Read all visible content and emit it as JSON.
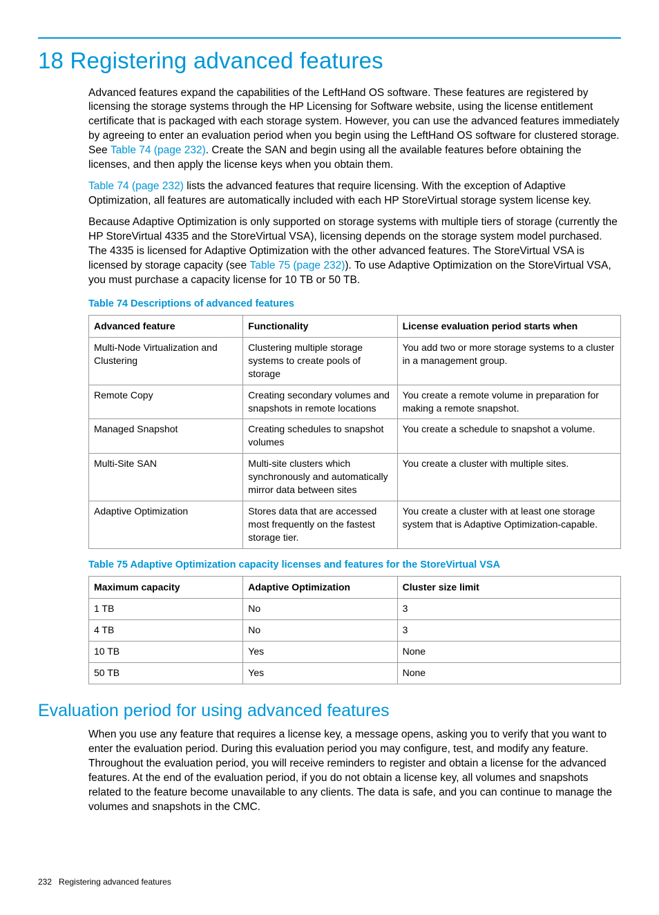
{
  "chapter": {
    "title": "18 Registering advanced features"
  },
  "paragraphs": {
    "p1a": "Advanced features expand the capabilities of the LeftHand OS software. These features are registered by licensing the storage systems through the HP Licensing for Software website, using the license entitlement certificate that is packaged with each storage system. However, you can use the advanced features immediately by agreeing to enter an evaluation period when you begin using the LeftHand OS software for clustered storage. See ",
    "p1_link": "Table 74 (page 232)",
    "p1b": ". Create the SAN and begin using all the available features before obtaining the licenses, and then apply the license keys when you obtain them.",
    "p2_link": "Table 74 (page 232)",
    "p2b": " lists the advanced features that require licensing. With the exception of Adaptive Optimization, all features are automatically included with each HP StoreVirtual storage system license key.",
    "p3a": "Because Adaptive Optimization is only supported on storage systems with multiple tiers of storage (currently the HP StoreVirtual 4335 and the StoreVirtual VSA), licensing depends on the storage system model purchased. The 4335 is licensed for Adaptive Optimization with the other advanced features. The StoreVirtual VSA is licensed by storage capacity (see ",
    "p3_link": "Table 75 (page 232)",
    "p3b": "). To use Adaptive Optimization on the StoreVirtual VSA, you must purchase a capacity license for 10 TB or 50 TB."
  },
  "table74": {
    "caption": "Table 74 Descriptions of advanced features",
    "headers": [
      "Advanced feature",
      "Functionality",
      "License evaluation period starts when"
    ],
    "rows": [
      [
        "Multi-Node Virtualization and Clustering",
        "Clustering multiple storage systems to create pools of storage",
        "You add two or more storage systems to a cluster in a management group."
      ],
      [
        "Remote Copy",
        "Creating secondary volumes and snapshots in remote locations",
        "You create a remote volume in preparation for making a remote snapshot."
      ],
      [
        "Managed Snapshot",
        "Creating schedules to snapshot volumes",
        "You create a schedule to snapshot a volume."
      ],
      [
        "Multi-Site SAN",
        "Multi-site clusters which synchronously and automatically mirror data between sites",
        "You create a cluster with multiple sites."
      ],
      [
        "Adaptive Optimization",
        "Stores data that are accessed most frequently on the fastest storage tier.",
        "You create a cluster with at least one storage system that is Adaptive Optimization-capable."
      ]
    ]
  },
  "table75": {
    "caption": "Table 75 Adaptive Optimization capacity licenses and features for the StoreVirtual VSA",
    "headers": [
      "Maximum capacity",
      "Adaptive Optimization",
      "Cluster size limit"
    ],
    "rows": [
      [
        "1 TB",
        "No",
        "3"
      ],
      [
        "4 TB",
        "No",
        "3"
      ],
      [
        "10 TB",
        "Yes",
        "None"
      ],
      [
        "50 TB",
        "Yes",
        "None"
      ]
    ]
  },
  "section2": {
    "title": "Evaluation period for using advanced features",
    "p1": "When you use any feature that requires a license key, a message opens, asking you to verify that you want to enter the evaluation period. During this evaluation period you may configure, test, and modify any feature. Throughout the evaluation period, you will receive reminders to register and obtain a license for the advanced features. At the end of the evaluation period, if you do not obtain a license key, all volumes and snapshots related to the feature become unavailable to any clients. The data is safe, and you can continue to manage the volumes and snapshots in the CMC."
  },
  "footer": {
    "page": "232",
    "running": "Registering advanced features"
  }
}
